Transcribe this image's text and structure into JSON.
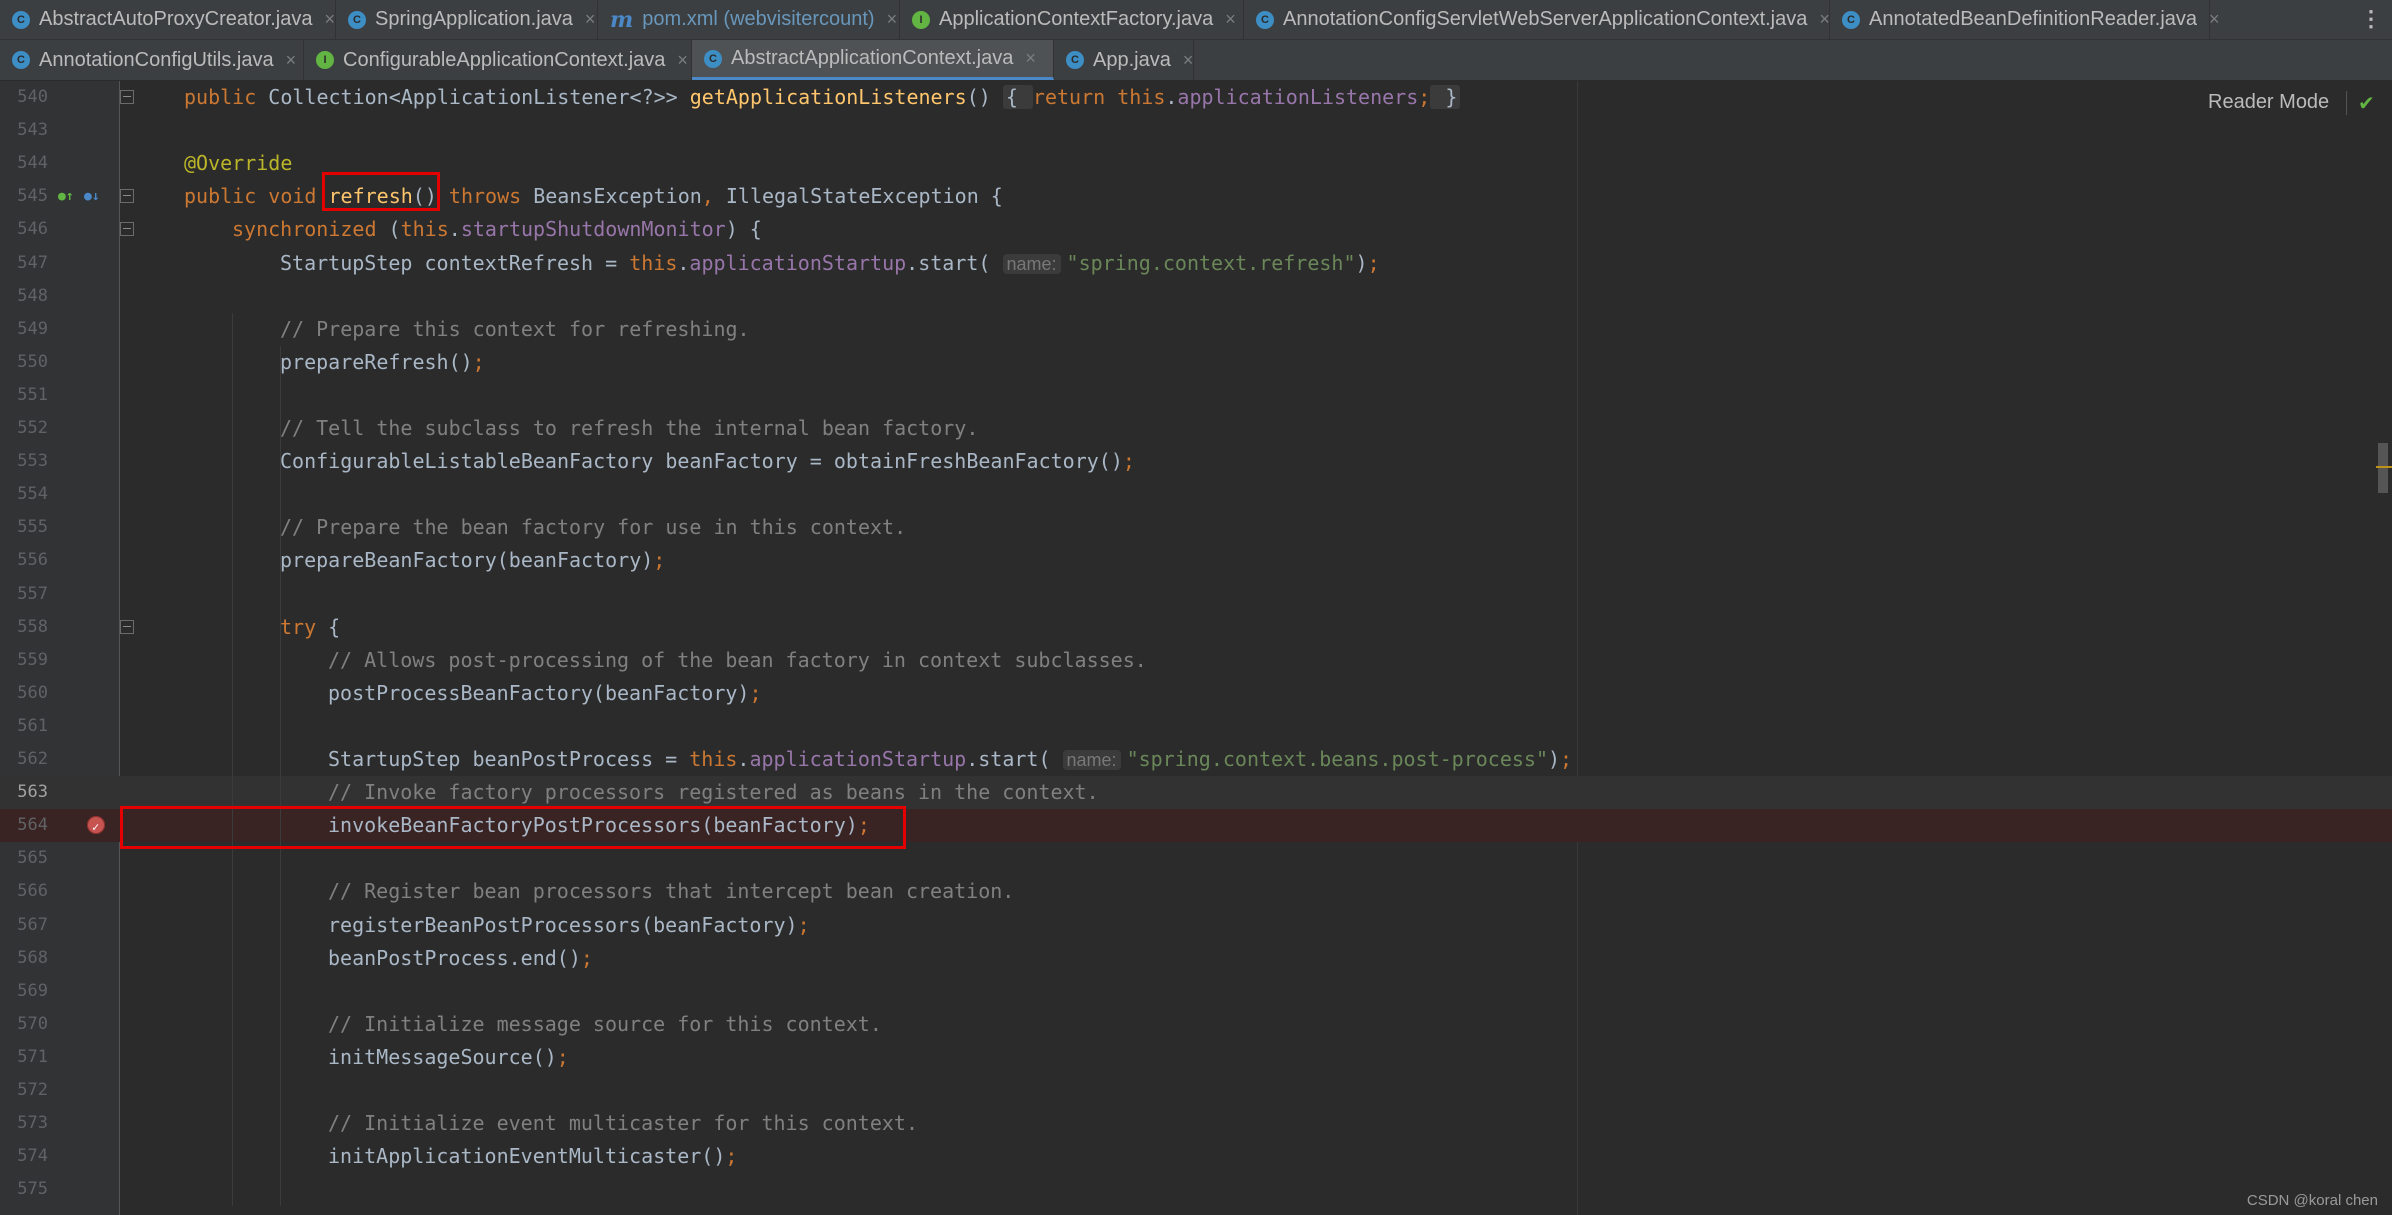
{
  "tabs_row1": [
    {
      "label": "AbstractAutoProxyCreator.java",
      "icon": "class-icon",
      "width": 336
    },
    {
      "label": "SpringApplication.java",
      "icon": "spring-class-icon",
      "width": 262
    },
    {
      "label": "pom.xml (webvisitercount)",
      "icon": "maven-icon",
      "width": 302
    },
    {
      "label": "ApplicationContextFactory.java",
      "icon": "interface-icon",
      "width": 344
    },
    {
      "label": "AnnotationConfigServletWebServerApplicationContext.java",
      "icon": "class-icon",
      "width": 586
    },
    {
      "label": "AnnotatedBeanDefinitionReader.java",
      "icon": "class-icon",
      "width": 380
    }
  ],
  "tabs_row2": [
    {
      "label": "AnnotationConfigUtils.java",
      "icon": "class-icon",
      "width": 304,
      "active": false
    },
    {
      "label": "ConfigurableApplicationContext.java",
      "icon": "interface-icon",
      "width": 388,
      "active": false
    },
    {
      "label": "AbstractApplicationContext.java",
      "icon": "class-icon",
      "width": 362,
      "active": true
    },
    {
      "label": "App.java",
      "icon": "spring-class-icon",
      "width": 140,
      "active": false
    }
  ],
  "more_tabs": "⋮",
  "tab_close": "×",
  "reader_mode": "Reader Mode",
  "watermark": "CSDN @koral chen",
  "editor": {
    "current_line": "563",
    "breakpoint_line": "564",
    "lines": [
      {
        "n": "540",
        "fold": true,
        "indent": 0,
        "tokens": [
          [
            "kw",
            "public "
          ],
          [
            "",
            "Collection<ApplicationListener<?>> "
          ],
          [
            "fn",
            "getApplicationListeners"
          ],
          [
            "",
            "() "
          ],
          [
            "brace",
            "{ "
          ],
          [
            "kw",
            "return "
          ],
          [
            "kw",
            "this"
          ],
          [
            "",
            "."
          ],
          [
            "field",
            "applicationListeners"
          ],
          [
            "kw",
            ";"
          ],
          [
            "brace",
            " }"
          ]
        ]
      },
      {
        "n": "543",
        "indent": 0,
        "tokens": []
      },
      {
        "n": "544",
        "indent": 0,
        "tokens": [
          [
            "ann",
            "@Override"
          ]
        ]
      },
      {
        "n": "545",
        "fold": true,
        "icons": true,
        "indent": 0,
        "tokens": [
          [
            "kw",
            "public void "
          ],
          [
            "fn",
            "refresh"
          ],
          [
            "",
            "() "
          ],
          [
            "kw",
            "throws "
          ],
          [
            "",
            "BeansException"
          ],
          [
            "kw",
            ", "
          ],
          [
            "",
            "IllegalStateException {"
          ]
        ]
      },
      {
        "n": "546",
        "fold": true,
        "indent": 1,
        "tokens": [
          [
            "kw",
            "synchronized "
          ],
          [
            "",
            "("
          ],
          [
            "kw",
            "this"
          ],
          [
            "",
            "."
          ],
          [
            "field",
            "startupShutdownMonitor"
          ],
          [
            "",
            ") {"
          ]
        ]
      },
      {
        "n": "547",
        "indent": 2,
        "tokens": [
          [
            "",
            "StartupStep contextRefresh = "
          ],
          [
            "kw",
            "this"
          ],
          [
            "",
            "."
          ],
          [
            "field",
            "applicationStartup"
          ],
          [
            "",
            ".start( "
          ],
          [
            "hint",
            "name:"
          ],
          [
            "str",
            "\"spring.context.refresh\""
          ],
          [
            "",
            ")"
          ],
          [
            "kw",
            ";"
          ]
        ]
      },
      {
        "n": "548",
        "indent": 2,
        "tokens": []
      },
      {
        "n": "549",
        "indent": 2,
        "tokens": [
          [
            "cmt",
            "// Prepare this context for refreshing."
          ]
        ]
      },
      {
        "n": "550",
        "indent": 2,
        "tokens": [
          [
            "",
            "prepareRefresh()"
          ],
          [
            "kw",
            ";"
          ]
        ]
      },
      {
        "n": "551",
        "indent": 2,
        "tokens": []
      },
      {
        "n": "552",
        "indent": 2,
        "tokens": [
          [
            "cmt",
            "// Tell the subclass to refresh the internal bean factory."
          ]
        ]
      },
      {
        "n": "553",
        "indent": 2,
        "tokens": [
          [
            "",
            "ConfigurableListableBeanFactory beanFactory = obtainFreshBeanFactory()"
          ],
          [
            "kw",
            ";"
          ]
        ]
      },
      {
        "n": "554",
        "indent": 2,
        "tokens": []
      },
      {
        "n": "555",
        "indent": 2,
        "tokens": [
          [
            "cmt",
            "// Prepare the bean factory for use in this context."
          ]
        ]
      },
      {
        "n": "556",
        "indent": 2,
        "tokens": [
          [
            "",
            "prepareBeanFactory(beanFactory)"
          ],
          [
            "kw",
            ";"
          ]
        ]
      },
      {
        "n": "557",
        "indent": 2,
        "tokens": []
      },
      {
        "n": "558",
        "fold": true,
        "indent": 2,
        "tokens": [
          [
            "kw",
            "try "
          ],
          [
            "",
            "{"
          ]
        ]
      },
      {
        "n": "559",
        "indent": 3,
        "tokens": [
          [
            "cmt",
            "// Allows post-processing of the bean factory in context subclasses."
          ]
        ]
      },
      {
        "n": "560",
        "indent": 3,
        "tokens": [
          [
            "",
            "postProcessBeanFactory(beanFactory)"
          ],
          [
            "kw",
            ";"
          ]
        ]
      },
      {
        "n": "561",
        "indent": 3,
        "tokens": []
      },
      {
        "n": "562",
        "indent": 3,
        "tokens": [
          [
            "",
            "StartupStep beanPostProcess = "
          ],
          [
            "kw",
            "this"
          ],
          [
            "",
            "."
          ],
          [
            "field",
            "applicationStartup"
          ],
          [
            "",
            ".start( "
          ],
          [
            "hint",
            "name:"
          ],
          [
            "str",
            "\"spring.context.beans.post-process\""
          ],
          [
            "",
            ")"
          ],
          [
            "kw",
            ";"
          ]
        ]
      },
      {
        "n": "563",
        "indent": 3,
        "tokens": [
          [
            "cmt",
            "// Invoke factory processors registered as beans in the context."
          ]
        ]
      },
      {
        "n": "564",
        "indent": 3,
        "tokens": [
          [
            "",
            "invokeBeanFactoryPostProcessors(beanFactory)"
          ],
          [
            "kw",
            ";"
          ]
        ]
      },
      {
        "n": "565",
        "indent": 3,
        "tokens": []
      },
      {
        "n": "566",
        "indent": 3,
        "tokens": [
          [
            "cmt",
            "// Register bean processors that intercept bean creation."
          ]
        ]
      },
      {
        "n": "567",
        "indent": 3,
        "tokens": [
          [
            "",
            "registerBeanPostProcessors(beanFactory)"
          ],
          [
            "kw",
            ";"
          ]
        ]
      },
      {
        "n": "568",
        "indent": 3,
        "tokens": [
          [
            "",
            "beanPostProcess.end()"
          ],
          [
            "kw",
            ";"
          ]
        ]
      },
      {
        "n": "569",
        "indent": 3,
        "tokens": []
      },
      {
        "n": "570",
        "indent": 3,
        "tokens": [
          [
            "cmt",
            "// Initialize message source for this context."
          ]
        ]
      },
      {
        "n": "571",
        "indent": 3,
        "tokens": [
          [
            "",
            "initMessageSource()"
          ],
          [
            "kw",
            ";"
          ]
        ]
      },
      {
        "n": "572",
        "indent": 3,
        "tokens": []
      },
      {
        "n": "573",
        "indent": 3,
        "tokens": [
          [
            "cmt",
            "// Initialize event multicaster for this context."
          ]
        ]
      },
      {
        "n": "574",
        "indent": 3,
        "tokens": [
          [
            "",
            "initApplicationEventMulticaster()"
          ],
          [
            "kw",
            ";"
          ]
        ]
      },
      {
        "n": "575",
        "indent": 3,
        "tokens": []
      }
    ]
  }
}
